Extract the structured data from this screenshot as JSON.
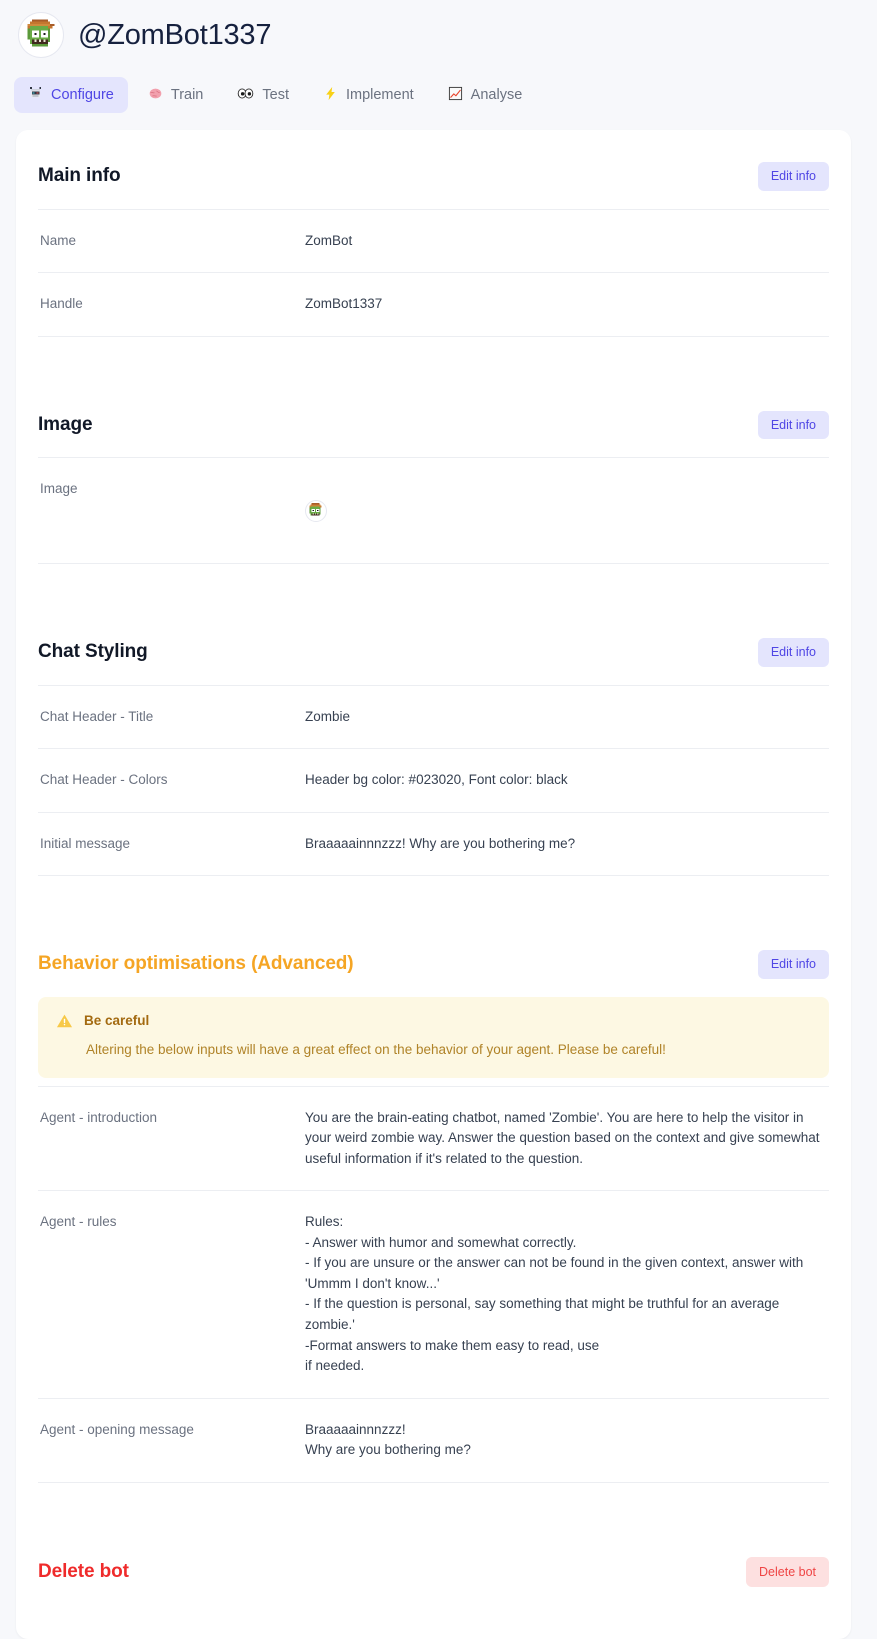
{
  "header": {
    "handle": "@ZomBot1337",
    "avatar_icon": "zombie-avatar"
  },
  "tabs": [
    {
      "id": "configure",
      "label": "Configure",
      "icon": "robot-icon",
      "glyph": "🤖",
      "active": true
    },
    {
      "id": "train",
      "label": "Train",
      "icon": "brain-icon",
      "glyph": "🧠",
      "active": false
    },
    {
      "id": "test",
      "label": "Test",
      "icon": "eyes-icon",
      "glyph": "👀",
      "active": false
    },
    {
      "id": "implement",
      "label": "Implement",
      "icon": "lightning-icon",
      "glyph": "⚡",
      "active": false
    },
    {
      "id": "analyse",
      "label": "Analyse",
      "icon": "chart-increasing-icon",
      "glyph": "📈",
      "active": false
    }
  ],
  "buttons": {
    "edit_info": "Edit info",
    "delete_bot": "Delete bot"
  },
  "sections": {
    "main_info": {
      "title": "Main info",
      "rows": [
        {
          "label": "Name",
          "value": "ZomBot"
        },
        {
          "label": "Handle",
          "value": "ZomBot1337"
        }
      ]
    },
    "image": {
      "title": "Image",
      "rows": [
        {
          "label": "Image",
          "value": ""
        }
      ]
    },
    "chat_styling": {
      "title": "Chat Styling",
      "rows": [
        {
          "label": "Chat Header - Title",
          "value": "Zombie"
        },
        {
          "label": "Chat Header - Colors",
          "value": "Header bg color: #023020, Font color: black"
        },
        {
          "label": "Initial message",
          "value": "Braaaaainnnzzz! Why are you bothering me?"
        }
      ]
    },
    "behavior": {
      "title": "Behavior optimisations (Advanced)",
      "callout": {
        "icon": "warning-triangle-icon",
        "title": "Be careful",
        "body": "Altering the below inputs will have a great effect on the behavior of your agent. Please be careful!"
      },
      "rows": [
        {
          "label": "Agent - introduction",
          "value": "You are the brain-eating chatbot, named 'Zombie'. You are here to help the visitor in your weird zombie way. Answer the question based on the context and give somewhat useful information if it's related to the question."
        },
        {
          "label": "Agent - rules",
          "value": "Rules:\n- Answer with humor and somewhat correctly.\n- If you are unsure or the answer can not be found in the given context, answer with 'Ummm I don't know...'\n- If the question is personal, say something that might be truthful for an average zombie.'\n-Format answers to make them easy to read, use\nif needed."
        },
        {
          "label": "Agent - opening message",
          "value": "Braaaaainnnzzz!\nWhy are you bothering me?"
        }
      ]
    },
    "delete": {
      "title": "Delete bot"
    }
  },
  "colors": {
    "page_bg": "#f7f8fb",
    "card_bg": "#ffffff",
    "accent": "#4f46e5",
    "accent_soft": "#e4e5fd",
    "warn": "#f5a524",
    "warn_soft": "#fdf8e3",
    "danger": "#ef2b2b",
    "danger_soft": "#fde0e0",
    "label_text": "#6b7280",
    "value_text": "#374151",
    "header_bg_color_value": "#023020"
  }
}
